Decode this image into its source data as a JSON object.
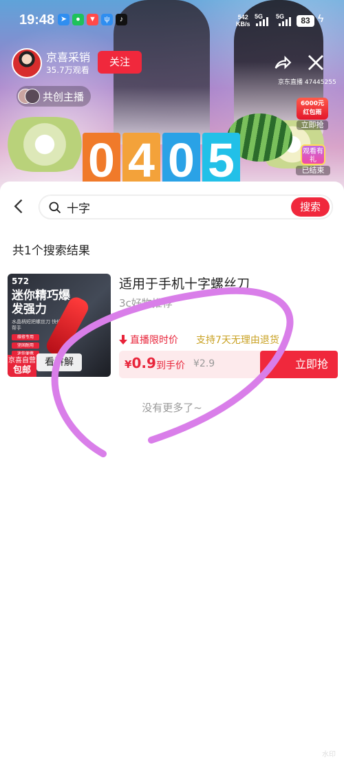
{
  "status_bar": {
    "time": "19:48",
    "net_speed_value": "542",
    "net_speed_unit": "KB/s",
    "sim1_label": "5G",
    "sim2_label": "5G",
    "battery": "83"
  },
  "live": {
    "anchor_name": "京喜采销",
    "anchor_views": "35.7万观看",
    "follow_label": "关注",
    "cohost_label": "共创主播",
    "room_id": "京东直播 47445255",
    "redpack_amount": "6000元",
    "redpack_text": "红包雨",
    "redpack_button": "立即抢",
    "gift_top": "观看有礼",
    "gift_status": "已结束",
    "board_digits": [
      "0",
      "4",
      "0",
      "5"
    ]
  },
  "search": {
    "query": "十字",
    "button": "搜索"
  },
  "results": {
    "count_text": "共1个搜索结果",
    "no_more": "没有更多了~"
  },
  "product": {
    "title": "适用于手机十字螺丝刀",
    "subtitle": "3c好物推荐",
    "live_price_tag": "直播限时价",
    "return_policy": "支持7天无理由退货",
    "price_symbol": "¥",
    "price": "0.9",
    "price_label": "到手价",
    "original_price": "¥2.9",
    "buy_label": "立即抢",
    "thumb_number": "572",
    "thumb_title": "迷你精巧爆发强力",
    "thumb_sub": "水晶柄短把螺丝刀 快修好帮手",
    "thumb_tags": [
      "维修专用",
      "坚固耐用",
      "迷你便携"
    ],
    "thumb_badge_top": "京喜自营",
    "thumb_badge_bottom": "包邮",
    "explain_label": "看讲解"
  },
  "colors": {
    "accent_red": "#f0283c",
    "price_bg": "#fdeaec",
    "return_gold": "#c8a020",
    "scribble": "#d97ee9"
  }
}
